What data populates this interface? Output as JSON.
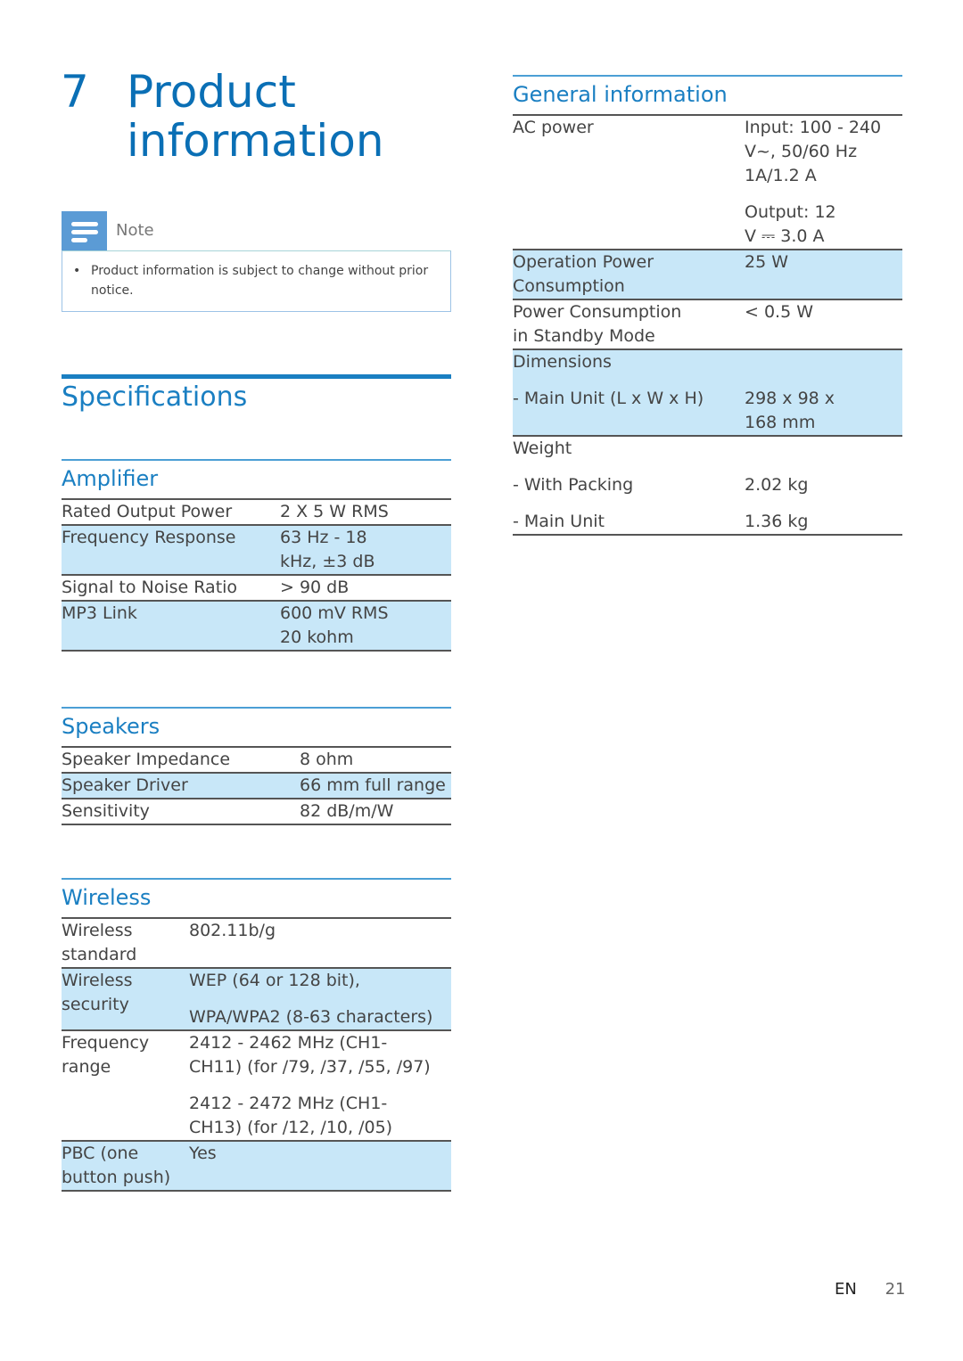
{
  "chapter": {
    "number": "7",
    "title_line1": "Product",
    "title_line2": "information"
  },
  "note": {
    "icon": "note-lines-icon",
    "label": "Note",
    "bullet": "•",
    "text": "Product information is subject to change without prior notice."
  },
  "specifications_title": "Specifications",
  "amplifier": {
    "title": "Amplifier",
    "rows": [
      {
        "key": "Rated Output Power",
        "values": [
          "2 X 5 W RMS"
        ],
        "shaded": false
      },
      {
        "key": "Frequency Response",
        "values": [
          "63 Hz - 18",
          "kHz, ±3 dB"
        ],
        "shaded": true
      },
      {
        "key": "Signal to Noise Ratio",
        "values": [
          "> 90 dB"
        ],
        "shaded": false
      },
      {
        "key": "MP3 Link",
        "values": [
          "600 mV RMS",
          "20 kohm"
        ],
        "shaded": true
      }
    ]
  },
  "speakers": {
    "title": "Speakers",
    "rows": [
      {
        "key": "Speaker Impedance",
        "values": [
          "8 ohm"
        ],
        "shaded": false
      },
      {
        "key": "Speaker Driver",
        "values": [
          "66 mm full range"
        ],
        "shaded": true
      },
      {
        "key": "Sensitivity",
        "values": [
          "82 dB/m/W"
        ],
        "shaded": false
      }
    ]
  },
  "wireless": {
    "title": "Wireless",
    "rows": [
      {
        "key": [
          "Wireless",
          "standard"
        ],
        "values": [
          "802.11b/g"
        ],
        "shaded": false
      },
      {
        "key": [
          "Wireless",
          "security"
        ],
        "values": [
          "WEP (64 or 128 bit),",
          "WPA/WPA2 (8-63 characters)"
        ],
        "shaded": true
      },
      {
        "key": [
          "Frequency",
          "range"
        ],
        "values": [
          "2412 - 2462 MHz (CH1-",
          "CH11) (for /79, /37, /55, /97)",
          "2412 - 2472 MHz (CH1-",
          "CH13) (for /12, /10, /05)"
        ],
        "shaded": false
      },
      {
        "key": [
          "PBC (one",
          "button push)"
        ],
        "values": [
          "Yes"
        ],
        "shaded": true
      }
    ]
  },
  "general": {
    "title": "General information",
    "rows": [
      {
        "key": [
          "AC power"
        ],
        "values": [
          "Input: 100 - 240",
          "V~, 50/60 Hz",
          "1A/1.2 A",
          "Output: 12",
          "V ⎓ 3.0 A"
        ],
        "shaded": false
      },
      {
        "key": [
          "Operation Power",
          "Consumption"
        ],
        "values": [
          "25 W"
        ],
        "shaded": true
      },
      {
        "key": [
          "Power Consumption",
          "in Standby Mode"
        ],
        "values": [
          "< 0.5 W"
        ],
        "shaded": false
      },
      {
        "key": [
          "Dimensions",
          " - Main Unit (L x W x H)"
        ],
        "values": [
          "",
          "298 x 98 x",
          "168 mm"
        ],
        "shaded": true
      },
      {
        "key": [
          "Weight",
          " - With Packing",
          " - Main Unit"
        ],
        "values": [
          "",
          "2.02 kg",
          "1.36 kg"
        ],
        "shaded": false
      }
    ]
  },
  "footer": {
    "language": "EN",
    "page": "21"
  }
}
